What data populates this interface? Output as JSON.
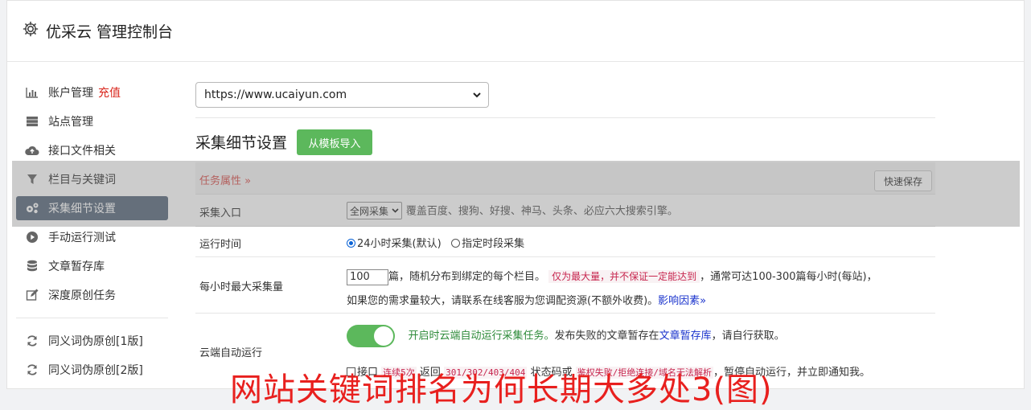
{
  "app": {
    "title": "优采云 管理控制台"
  },
  "sidebar": {
    "items": [
      {
        "label": "账户管理",
        "extra": "充值",
        "icon": "bar-chart-icon"
      },
      {
        "label": "站点管理",
        "icon": "server-icon"
      },
      {
        "label": "接口文件相关",
        "icon": "cloud-upload-icon"
      },
      {
        "label": "栏目与关键词",
        "icon": "filter-icon"
      },
      {
        "label": "采集细节设置",
        "icon": "gears-icon"
      },
      {
        "label": "手动运行测试",
        "icon": "play-circle-icon"
      },
      {
        "label": "文章暂存库",
        "icon": "database-icon"
      },
      {
        "label": "深度原创任务",
        "icon": "edit-icon"
      },
      {
        "label": "同义词伪原创[1版]",
        "icon": "refresh-icon"
      },
      {
        "label": "同义词伪原创[2版]",
        "icon": "refresh-icon"
      }
    ]
  },
  "main": {
    "site_select": "https://www.ucaiyun.com",
    "section_title": "采集细节设置",
    "import_button": "从模板导入",
    "task_attr": "任务属性",
    "quick_save": "快速保存",
    "rows": {
      "entry": {
        "label": "采集入口",
        "select": "全网采集",
        "desc": "覆盖百度、搜狗、好搜、神马、头条、必应六大搜索引擎。"
      },
      "runtime": {
        "label": "运行时间",
        "opt1": "24小时采集(默认)",
        "opt2": "指定时段采集"
      },
      "max": {
        "label": "每小时最大采集量",
        "value": "100",
        "text1": "篇，随机分布到绑定的每个栏目。",
        "warn": "仅为最大量，并不保证一定能达到",
        "text2": "，通常可达100-300篇每小时(每站)，",
        "text3": "如果您的需求量较大，请联系在线客服为您调配资源(不额外收费)。",
        "link": "影响因素"
      },
      "cloud": {
        "label": "云端自动运行",
        "green": "开启时云端自动运行采集任务。",
        "text1": "发布失败的文章暂存在",
        "link": "文章暂存库",
        "text2": "，请自行获取。",
        "cb_label": "接口",
        "mono1": "连续5次",
        "text3": "返回",
        "mono2": "301/302/403/404",
        "text4": "状态码或",
        "mono3": "鉴权失败/拒绝连接/域名无法解析",
        "text5": "，暂停自动运行，并立即通知我。"
      }
    }
  },
  "watermark": "网站关键词排名为何长期大多处3(图)"
}
